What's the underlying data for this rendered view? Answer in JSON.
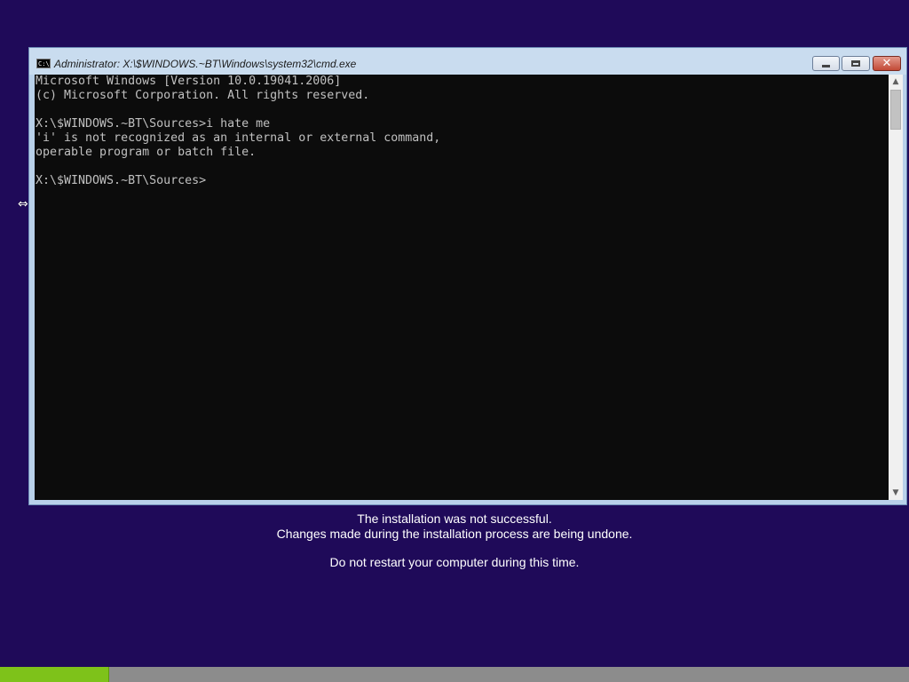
{
  "window": {
    "title": "Administrator: X:\\$WINDOWS.~BT\\Windows\\system32\\cmd.exe",
    "icon": "cmd-icon",
    "icon_text": "C:\\",
    "buttons": {
      "minimize": "minimize-icon",
      "maximize": "maximize-icon",
      "close": "close-icon",
      "close_glyph": "✕"
    }
  },
  "console": {
    "lines": [
      "Microsoft Windows [Version 10.0.19041.2006]",
      "(c) Microsoft Corporation. All rights reserved.",
      "",
      "X:\\$WINDOWS.~BT\\Sources>i hate me",
      "'i' is not recognized as an internal or external command,",
      "operable program or batch file.",
      "",
      "X:\\$WINDOWS.~BT\\Sources>"
    ],
    "scroll_up_glyph": "▲",
    "scroll_down_glyph": "▼"
  },
  "cursor": {
    "icon": "resize-horizontal-icon",
    "glyph": "⇔"
  },
  "status": {
    "line1": "The installation was not successful.",
    "line2": "Changes made during the installation process are being undone.",
    "line3": "Do not restart your computer during this time."
  },
  "progress": {
    "fraction": 0.12
  },
  "colors": {
    "background": "#1f0a59",
    "console_bg": "#0c0c0c",
    "console_text": "#c0c0c0",
    "progress_fill": "#7ec21a",
    "progress_track": "#8c8c8c"
  }
}
